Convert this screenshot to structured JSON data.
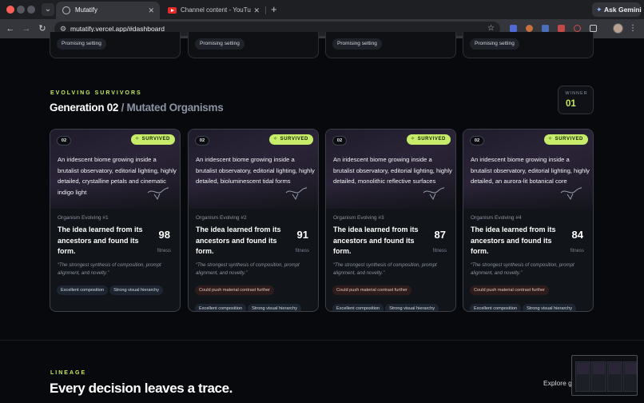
{
  "browser": {
    "tabs": [
      {
        "title": "Mutatify",
        "active": true
      },
      {
        "title": "Channel content - YouTube Studio",
        "active": false
      }
    ],
    "new_tab": "+",
    "url": "mutatify.vercel.app/#dashboard",
    "gemini_label": "Ask Gemini"
  },
  "top_cards": [
    "Promising setting",
    "Promising setting",
    "Promising setting",
    "Promising setting"
  ],
  "section": {
    "eyebrow": "EVOLVING SURVIVORS",
    "title": "Generation 02",
    "title_sub": " / Mutated Organisms",
    "winner_label": "WINNER",
    "winner_value": "01"
  },
  "cards": [
    {
      "gen": "02",
      "status": "SURVIVED",
      "prompt": "An iridescent biome growing inside a brutalist observatory, editorial lighting, highly detailed, crystalline petals and cinematic indigo light",
      "organism": "Organism Evolving #1",
      "idea": "The idea learned from its ancestors and found its form.",
      "score": "98",
      "score_label": "fitness",
      "quote": "“The strongest synthesis of composition, prompt alignment, and novelty.”",
      "tags": [
        {
          "label": "Excellent composition",
          "kind": "pos"
        },
        {
          "label": "Strong visual hierarchy",
          "kind": "pos"
        }
      ]
    },
    {
      "gen": "02",
      "status": "SURVIVED",
      "prompt": "An iridescent biome growing inside a brutalist observatory, editorial lighting, highly detailed, bioluminescent tidal forms",
      "organism": "Organism Evolving #2",
      "idea": "The idea learned from its ancestors and found its form.",
      "score": "91",
      "score_label": "fitness",
      "quote": "“The strongest synthesis of composition, prompt alignment, and novelty.”",
      "tags": [
        {
          "label": "Could push material contrast further",
          "kind": "warn"
        },
        {
          "label": "Excellent composition",
          "kind": "pos"
        },
        {
          "label": "Strong visual hierarchy",
          "kind": "pos"
        }
      ]
    },
    {
      "gen": "02",
      "status": "SURVIVED",
      "prompt": "An iridescent biome growing inside a brutalist observatory, editorial lighting, highly detailed, monolithic reflective surfaces",
      "organism": "Organism Evolving #3",
      "idea": "The idea learned from its ancestors and found its form.",
      "score": "87",
      "score_label": "fitness",
      "quote": "“The strongest synthesis of composition, prompt alignment, and novelty.”",
      "tags": [
        {
          "label": "Could push material contrast further",
          "kind": "warn"
        },
        {
          "label": "Excellent composition",
          "kind": "pos"
        },
        {
          "label": "Strong visual hierarchy",
          "kind": "pos"
        }
      ]
    },
    {
      "gen": "02",
      "status": "SURVIVED",
      "prompt": "An iridescent biome growing inside a brutalist observatory, editorial lighting, highly detailed, an aurora-lit botanical core",
      "organism": "Organism Evolving #4",
      "idea": "The idea learned from its ancestors and found its form.",
      "score": "84",
      "score_label": "fitness",
      "quote": "“The strongest synthesis of composition, prompt alignment, and novelty.”",
      "tags": [
        {
          "label": "Could push material contrast further",
          "kind": "warn"
        },
        {
          "label": "Excellent composition",
          "kind": "pos"
        },
        {
          "label": "Strong visual hierarchy",
          "kind": "pos"
        }
      ]
    }
  ],
  "lineage": {
    "eyebrow": "LINEAGE",
    "title": "Every decision leaves a trace.",
    "explore": "Explore g"
  },
  "colors": {
    "accent": "#c6e85a",
    "survived_bg": "#c6ec6a",
    "page_bg": "#08090c"
  }
}
